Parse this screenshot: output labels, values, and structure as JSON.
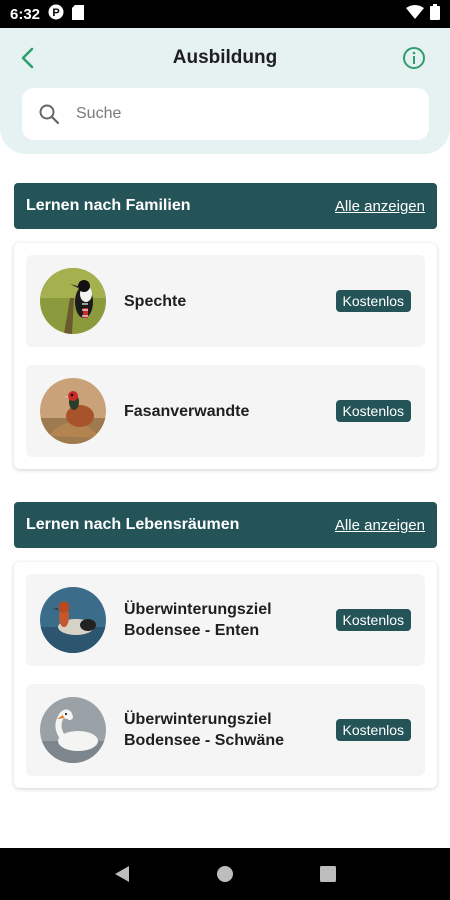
{
  "status_bar": {
    "time": "6:32",
    "icons": [
      "notification-p-icon",
      "sd-card-icon",
      "wifi-icon",
      "battery-icon"
    ]
  },
  "header": {
    "title": "Ausbildung",
    "back_icon": "chevron-left-icon",
    "info_icon": "info-icon"
  },
  "search": {
    "placeholder": "Suche",
    "value": ""
  },
  "sections": [
    {
      "title": "Lernen nach Familien",
      "link": "Alle anzeigen",
      "items": [
        {
          "name": "Spechte",
          "badge": "Kostenlos",
          "image": "woodpecker"
        },
        {
          "name": "Fasanverwandte",
          "badge": "Kostenlos",
          "image": "pheasant"
        }
      ]
    },
    {
      "title": "Lernen nach Lebensräumen",
      "link": "Alle anzeigen",
      "items": [
        {
          "name": "Überwinterungsziel Bodensee - Enten",
          "badge": "Kostenlos",
          "image": "duck"
        },
        {
          "name": "Überwinterungsziel Bodensee - Schwäne",
          "badge": "Kostenlos",
          "image": "swan"
        }
      ]
    }
  ],
  "colors": {
    "accent": "#245458",
    "header_bg": "#e6f2f1",
    "icon_green": "#2e9e6e"
  },
  "nav": {
    "icons": [
      "back-triangle-icon",
      "home-circle-icon",
      "recents-square-icon"
    ]
  }
}
